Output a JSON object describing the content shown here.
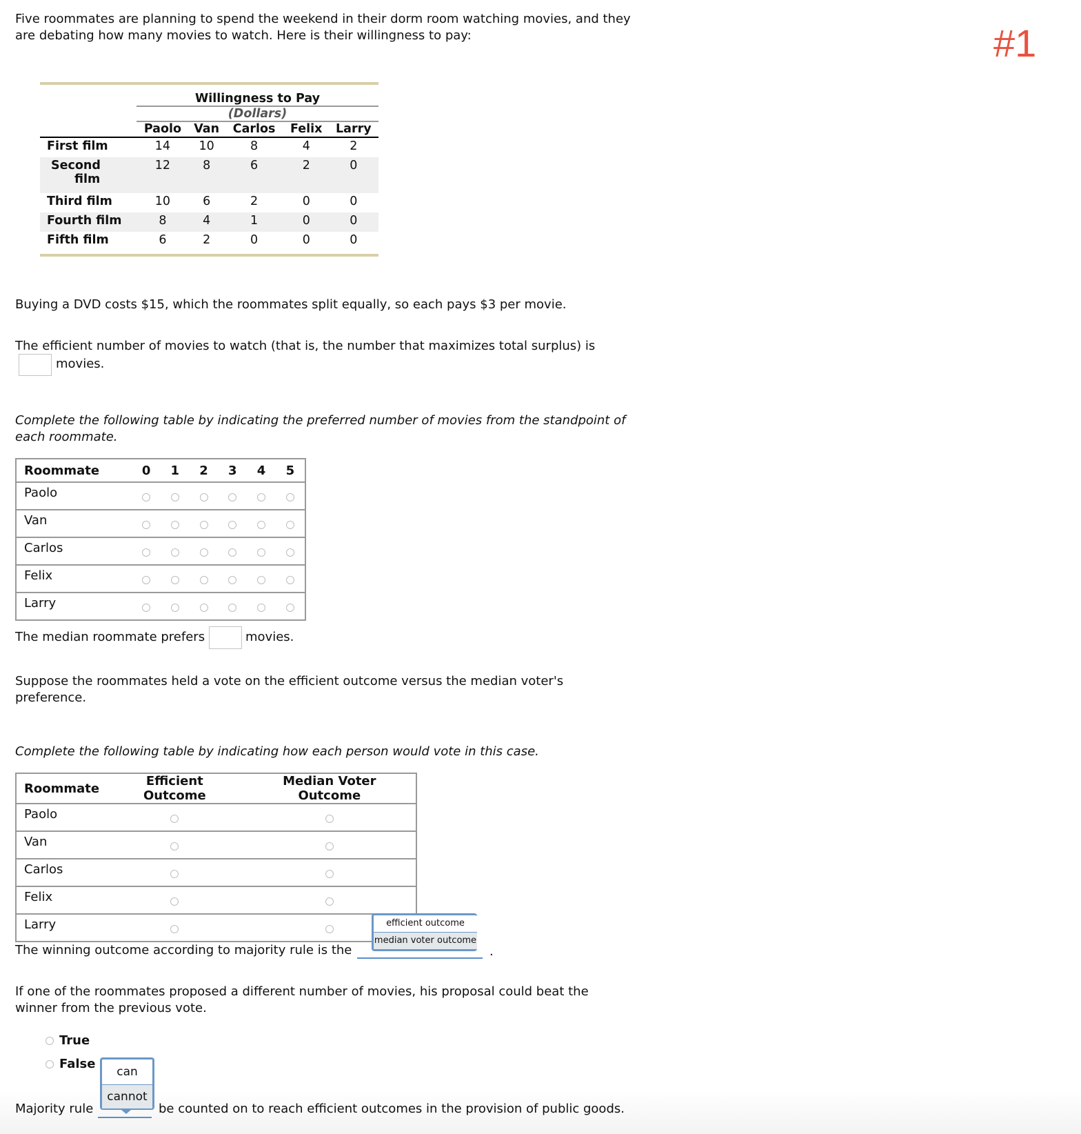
{
  "badge": "#1",
  "intro": {
    "line1": "Five roommates are planning to spend the weekend in their dorm room watching movies, and they",
    "line2": "are debating how many movies to watch. Here is their willingness to pay:"
  },
  "wtp_table": {
    "caption": "Willingness to Pay",
    "subcaption": "(Dollars)",
    "columns": [
      "Paolo",
      "Van",
      "Carlos",
      "Felix",
      "Larry"
    ],
    "rows": [
      {
        "label": "First film",
        "values": [
          "14",
          "10",
          "8",
          "4",
          "2"
        ]
      },
      {
        "label_l1": "Second",
        "label_l2": "film",
        "values": [
          "12",
          "8",
          "6",
          "2",
          "0"
        ]
      },
      {
        "label": "Third film",
        "values": [
          "10",
          "6",
          "2",
          "0",
          "0"
        ]
      },
      {
        "label": "Fourth film",
        "values": [
          "8",
          "4",
          "1",
          "0",
          "0"
        ]
      },
      {
        "label": "Fifth film",
        "values": [
          "6",
          "2",
          "0",
          "0",
          "0"
        ]
      }
    ]
  },
  "cost_text": "Buying a DVD costs $15, which the roommates split equally, so each pays $3 per movie.",
  "efficient_q": {
    "line1": "The efficient number of movies to watch (that is, the number that maximizes total surplus) is",
    "suffix": "movies.",
    "value": ""
  },
  "pref_instructions": {
    "line1": "Complete the following table by indicating the preferred number of movies from the standpoint of",
    "line2": "each roommate."
  },
  "pref_table": {
    "header": "Roommate",
    "options": [
      "0",
      "1",
      "2",
      "3",
      "4",
      "5"
    ],
    "roommates": [
      "Paolo",
      "Van",
      "Carlos",
      "Felix",
      "Larry"
    ]
  },
  "median_q": {
    "prefix": "The median roommate prefers",
    "suffix": "movies.",
    "value": ""
  },
  "vote_text": {
    "line1": "Suppose the roommates held a vote on the efficient outcome versus the median voter's",
    "line2": "preference."
  },
  "vote_instructions": "Complete the following table by indicating how each person would vote in this case.",
  "vote_table": {
    "headers": [
      "Roommate",
      "Efficient Outcome",
      "Median Voter Outcome"
    ],
    "roommates": [
      "Paolo",
      "Van",
      "Carlos",
      "Felix",
      "Larry"
    ]
  },
  "winning_q": {
    "prefix": "The winning outcome according to majority rule is the",
    "suffix": ".",
    "dropdown_options": [
      "efficient outcome",
      "median voter outcome"
    ],
    "highlighted_option": "median voter outcome"
  },
  "proposal_text": {
    "line1": "If one of the roommates proposed a different number of movies, his proposal could beat the",
    "line2": "winner from the previous vote."
  },
  "true_false": {
    "options": [
      "True",
      "False"
    ]
  },
  "majority_q": {
    "prefix": "Majority rule",
    "suffix": "be counted on to reach efficient outcomes in the provision of public goods.",
    "dropdown_options": [
      "can",
      "cannot"
    ],
    "highlighted_option": "cannot"
  }
}
